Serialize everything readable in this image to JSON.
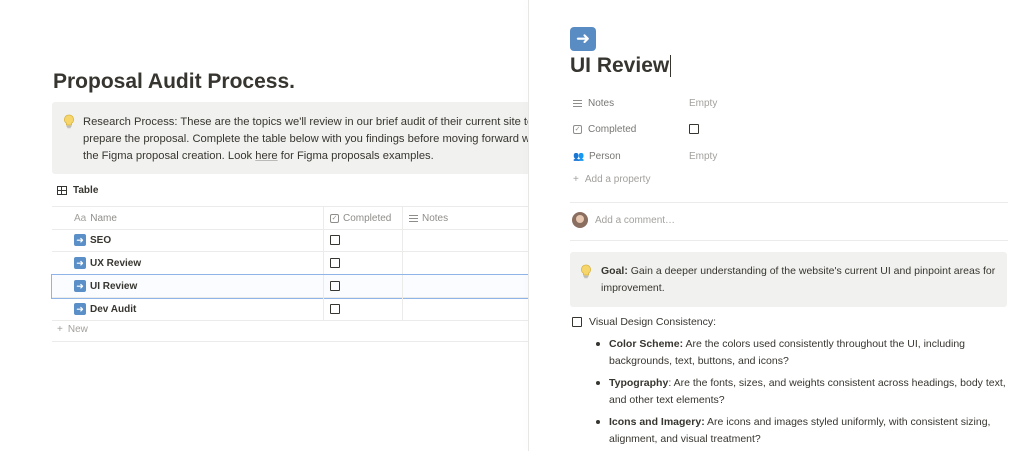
{
  "left": {
    "title": "Proposal Audit Process.",
    "callout": {
      "icon": "lightbulb-icon",
      "text_before_link": "Research Process: These are the topics we'll review in our brief audit of their current site to prepare the proposal. Complete the table below with you findings before moving forward with the Figma proposal creation. Look ",
      "link_text": "here",
      "text_after_link": " for Figma proposals examples."
    },
    "table_view_label": "Table",
    "columns": {
      "name": "Name",
      "completed": "Completed",
      "notes": "Notes",
      "name_prefix": "Aa"
    },
    "rows": [
      {
        "name": "SEO",
        "icon": "arrow-right-icon",
        "completed": false
      },
      {
        "name": "UX Review",
        "icon": "arrow-right-icon",
        "completed": false
      },
      {
        "name": "UI Review",
        "icon": "arrow-right-icon",
        "completed": false,
        "selected": true
      },
      {
        "name": "Dev Audit",
        "icon": "arrow-right-icon",
        "completed": false
      }
    ],
    "new_label": "New"
  },
  "right": {
    "page_icon": "arrow-right-icon",
    "title": "UI Review",
    "properties": [
      {
        "name": "Notes",
        "icon": "text-lines-icon",
        "value": "Empty"
      },
      {
        "name": "Completed",
        "icon": "checkbox-property-icon",
        "value": ""
      },
      {
        "name": "Person",
        "icon": "people-icon",
        "value": "Empty"
      }
    ],
    "add_property": "Add a property",
    "comment_placeholder": "Add a comment…",
    "goal": {
      "label": "Goal:",
      "text": " Gain a deeper understanding of the website's current UI and pinpoint areas for improvement."
    },
    "todo": {
      "label": "Visual Design Consistency:",
      "checked": false
    },
    "bullets": [
      {
        "bold": "Color Scheme:",
        "text": " Are the colors used consistently throughout the UI, including backgrounds, text, buttons, and icons?"
      },
      {
        "bold": "Typography",
        "text": ": Are the fonts, sizes, and weights consistent across headings, body text, and other text elements?"
      },
      {
        "bold": "Icons and Imagery:",
        "text": " Are icons and images styled uniformly, with consistent sizing, alignment, and visual treatment?"
      }
    ]
  },
  "colors": {
    "accent": "#5a8cc4",
    "callout_bg": "#f1f1ef",
    "selection": "#8fb5e8",
    "text": "#37352f",
    "muted": "#a3a19d"
  }
}
